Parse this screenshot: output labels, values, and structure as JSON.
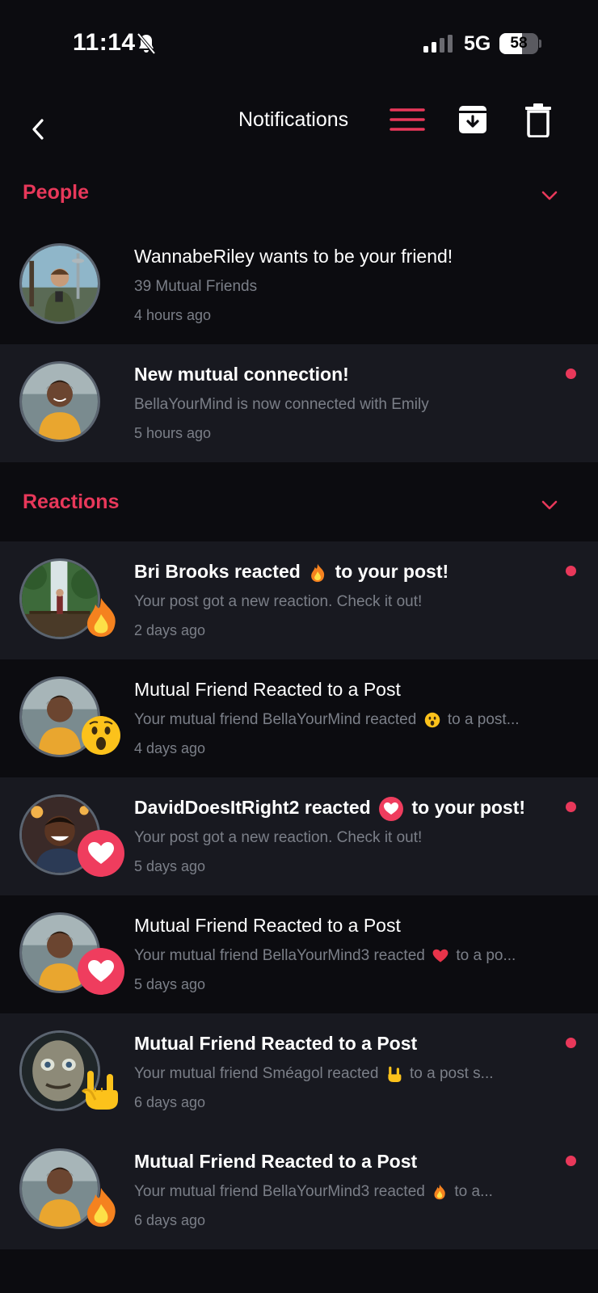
{
  "status_bar": {
    "time": "11:14",
    "network": "5G",
    "battery": "58",
    "battery_level_percent": 58
  },
  "header": {
    "title": "Notifications"
  },
  "colors": {
    "accent": "#e8385a",
    "background": "#0c0c10",
    "unread_row": "#181920",
    "muted_text": "#7b7f88"
  },
  "sections": [
    {
      "title": "People",
      "items": [
        {
          "title": "WannabeRiley wants to be your friend!",
          "subtitle": "39 Mutual Friends",
          "time": "4 hours ago",
          "bold": false,
          "unread": false,
          "reaction_icon": null
        },
        {
          "title": "New mutual connection!",
          "subtitle": "BellaYourMind is now connected with Emily",
          "time": "5 hours ago",
          "bold": true,
          "unread": true,
          "reaction_icon": null
        }
      ]
    },
    {
      "title": "Reactions",
      "items": [
        {
          "title_before": "Bri Brooks reacted",
          "title_after": "to your post!",
          "subtitle": "Your post got a new reaction. Check it out!",
          "time": "2 days ago",
          "bold": true,
          "unread": true,
          "reaction_icon": "fire-icon"
        },
        {
          "title": "Mutual Friend Reacted to a Post",
          "subtitle_before": "Your mutual friend BellaYourMind reacted",
          "subtitle_after": "to a post...",
          "time": "4 days ago",
          "bold": false,
          "unread": false,
          "reaction_icon": "surprised-face-icon"
        },
        {
          "title_before": "DavidDoesItRight2 reacted",
          "title_after": "to your post!",
          "subtitle": "Your post got a new reaction. Check it out!",
          "time": "5 days ago",
          "bold": true,
          "unread": true,
          "reaction_icon": "heart-icon"
        },
        {
          "title": "Mutual Friend Reacted to a Post",
          "subtitle_before": "Your mutual friend BellaYourMind3 reacted",
          "subtitle_after": "to a po...",
          "time": "5 days ago",
          "bold": false,
          "unread": false,
          "reaction_icon": "heart-icon"
        },
        {
          "title": "Mutual Friend Reacted to a Post",
          "subtitle_before": "Your mutual friend Sméagol reacted",
          "subtitle_after": "to a post s...",
          "time": "6 days ago",
          "bold": true,
          "unread": true,
          "reaction_icon": "rock-on-hand-icon"
        },
        {
          "title": "Mutual Friend Reacted to a Post",
          "subtitle_before": "Your mutual friend BellaYourMind3 reacted",
          "subtitle_after": "to a...",
          "time": "6 days ago",
          "bold": true,
          "unread": true,
          "reaction_icon": "fire-icon"
        }
      ]
    }
  ]
}
